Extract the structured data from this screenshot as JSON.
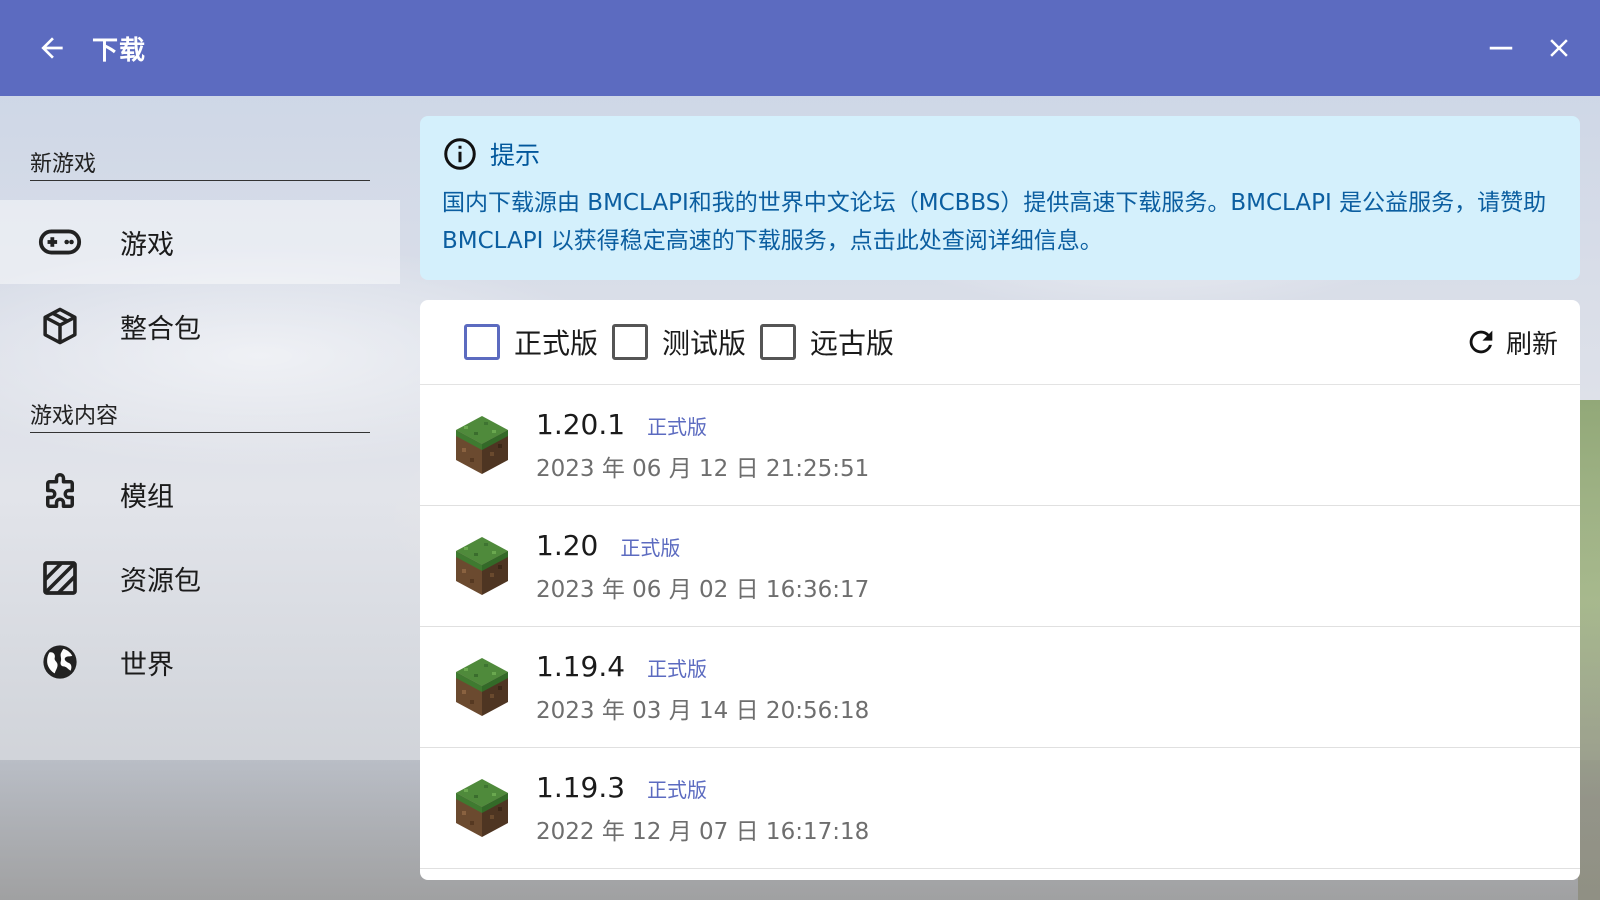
{
  "titlebar": {
    "title": "下载",
    "back_icon": "arrow-left-icon",
    "minimize_icon": "minimize-icon",
    "close_icon": "close-icon"
  },
  "sidebar": {
    "sections": [
      {
        "title": "新游戏",
        "items": [
          {
            "label": "游戏",
            "icon": "gamepad-icon",
            "active": true
          },
          {
            "label": "整合包",
            "icon": "package-icon",
            "active": false
          }
        ]
      },
      {
        "title": "游戏内容",
        "items": [
          {
            "label": "模组",
            "icon": "puzzle-icon",
            "active": false
          },
          {
            "label": "资源包",
            "icon": "texture-icon",
            "active": false
          },
          {
            "label": "世界",
            "icon": "globe-icon",
            "active": false
          }
        ]
      }
    ]
  },
  "hint": {
    "title": "提示",
    "icon": "info-icon",
    "text": "国内下载源由 BMCLAPI和我的世界中文论坛（MCBBS）提供高速下载服务。BMCLAPI 是公益服务，请赞助 BMCLAPI 以获得稳定高速的下载服务，点击此处查阅详细信息。"
  },
  "filters": {
    "release": "正式版",
    "snapshot": "测试版",
    "old": "远古版",
    "refresh": "刷新"
  },
  "versions": [
    {
      "version": "1.20.1",
      "type": "正式版",
      "date": "2023 年 06 月 12 日 21:25:51"
    },
    {
      "version": "1.20",
      "type": "正式版",
      "date": "2023 年 06 月 02 日 16:36:17"
    },
    {
      "version": "1.19.4",
      "type": "正式版",
      "date": "2023 年 03 月 14 日 20:56:18"
    },
    {
      "version": "1.19.3",
      "type": "正式版",
      "date": "2022 年 12 月 07 日 16:17:18"
    }
  ],
  "colors": {
    "accent": "#5c6bc0",
    "hint_bg": "#d4f0fc",
    "hint_text": "#0b5ea0"
  }
}
